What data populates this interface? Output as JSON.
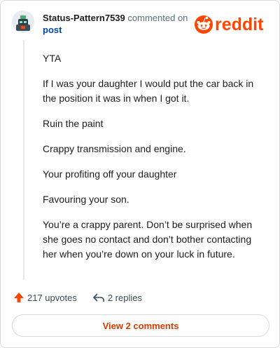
{
  "comment": {
    "author": "Status-Pattern7539",
    "action_text": "commented on",
    "post_link_label": "post",
    "body": [
      "YTA",
      "If I was your daughter I would put the car back in the position it was in when I got it.",
      "Ruin the paint",
      "Crappy transmission and engine.",
      "Your profiting off your daughter",
      "Favouring your son.",
      "You’re a crappy parent. Don’t be surprised when she goes no contact and don’t bother contacting her when you’re down on your luck in future."
    ]
  },
  "brand": {
    "logo_text": "reddit",
    "color": "#ff4500"
  },
  "footer": {
    "upvotes_label": "217 upvotes",
    "replies_label": "2 replies",
    "view_comments_label": "View 2 comments"
  },
  "icons": {
    "avatar": "avatar-icon",
    "upvote": "upvote-arrow-icon",
    "reply": "reply-arrow-icon",
    "logo": "reddit-snoo-icon"
  },
  "colors": {
    "upvote": "#ff4500",
    "link": "#0045ac",
    "button_text": "#d93a00"
  }
}
